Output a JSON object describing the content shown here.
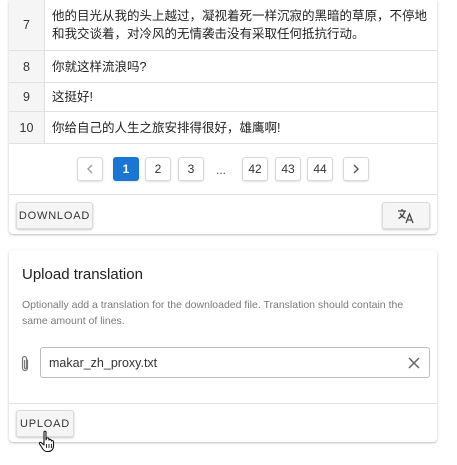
{
  "table": {
    "rows": [
      {
        "num": "7",
        "text": "他的目光从我的头上越过，凝视着死一样沉寂的黑暗的草原，不停地和我交谈着，对冷风的无情袭击没有采取任何抵抗行动。"
      },
      {
        "num": "8",
        "text": "你就这样流浪吗?"
      },
      {
        "num": "9",
        "text": "这挺好!"
      },
      {
        "num": "10",
        "text": "你给自己的人生之旅安排得很好，雄鹰啊!"
      }
    ]
  },
  "pagination": {
    "prev_icon": "chevron-left-icon",
    "next_icon": "chevron-right-icon",
    "pages": [
      "1",
      "2",
      "3",
      "42",
      "43",
      "44"
    ],
    "ellipsis": "...",
    "active_page": "1"
  },
  "actions": {
    "download_label": "DOWNLOAD",
    "translate_icon": "translate-icon"
  },
  "upload": {
    "title": "Upload translation",
    "description": "Optionally add a translation for the downloaded file. Translation should contain the same amount of lines.",
    "file_value": "makar_zh_proxy.txt",
    "attach_icon": "paperclip-icon",
    "clear_icon": "close-icon",
    "upload_label": "UPLOAD"
  },
  "colors": {
    "accent": "#1976d2",
    "row_number_bg": "#f5f5f5"
  }
}
